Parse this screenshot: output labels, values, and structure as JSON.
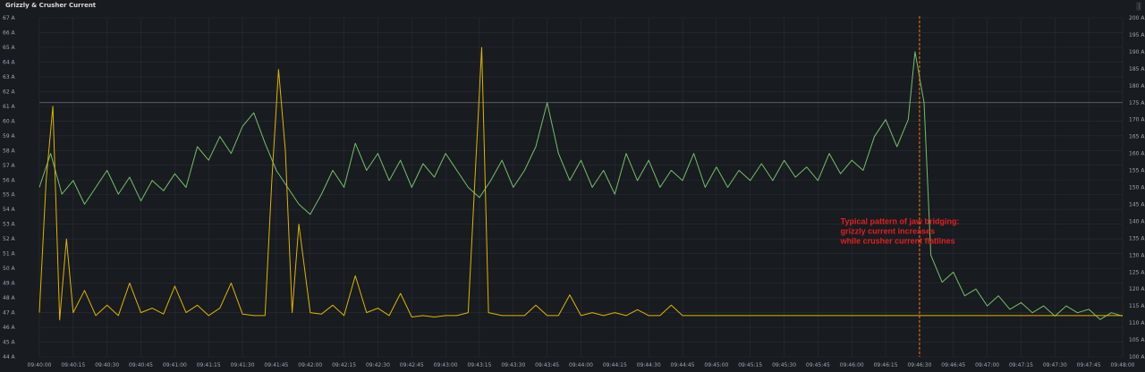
{
  "panel": {
    "title": "Grizzly & Crusher Current",
    "menu_glyph": "⋮"
  },
  "chart_data": {
    "type": "line",
    "title": "Grizzly & Crusher Current",
    "x_ticks": [
      "09:40:00",
      "09:40:15",
      "09:40:30",
      "09:40:45",
      "09:41:00",
      "09:41:15",
      "09:41:30",
      "09:41:45",
      "09:42:00",
      "09:42:15",
      "09:42:30",
      "09:42:45",
      "09:43:00",
      "09:43:15",
      "09:43:30",
      "09:43:45",
      "09:44:00",
      "09:44:15",
      "09:44:30",
      "09:44:45",
      "09:45:00",
      "09:45:15",
      "09:45:30",
      "09:45:45",
      "09:46:00",
      "09:46:15",
      "09:46:30",
      "09:46:45",
      "09:47:00",
      "09:47:15",
      "09:47:30",
      "09:47:45",
      "09:48:00"
    ],
    "xlim": [
      "09:40:00",
      "09:48:00"
    ],
    "y_left": {
      "ticks": [
        "44 A",
        "45 A",
        "46 A",
        "47 A",
        "48 A",
        "49 A",
        "50 A",
        "51 A",
        "52 A",
        "53 A",
        "54 A",
        "55 A",
        "56 A",
        "57 A",
        "58 A",
        "59 A",
        "60 A",
        "61 A",
        "62 A",
        "63 A",
        "64 A",
        "65 A",
        "66 A",
        "67 A"
      ],
      "range": [
        44,
        67
      ]
    },
    "y_right": {
      "ticks": [
        "100 A",
        "105 A",
        "110 A",
        "115 A",
        "120 A",
        "125 A",
        "130 A",
        "135 A",
        "140 A",
        "145 A",
        "150 A",
        "155 A",
        "160 A",
        "165 A",
        "170 A",
        "175 A",
        "180 A",
        "185 A",
        "190 A",
        "195 A",
        "200 A"
      ],
      "range": [
        100,
        200
      ]
    },
    "grid": true,
    "series": [
      {
        "color": "#73bf69",
        "axis": "right",
        "points": [
          [
            "09:40:00",
            150
          ],
          [
            "09:40:05",
            160
          ],
          [
            "09:40:10",
            148
          ],
          [
            "09:40:15",
            152
          ],
          [
            "09:40:20",
            145
          ],
          [
            "09:40:25",
            150
          ],
          [
            "09:40:30",
            155
          ],
          [
            "09:40:35",
            148
          ],
          [
            "09:40:40",
            153
          ],
          [
            "09:40:45",
            146
          ],
          [
            "09:40:50",
            152
          ],
          [
            "09:40:55",
            149
          ],
          [
            "09:41:00",
            154
          ],
          [
            "09:41:05",
            150
          ],
          [
            "09:41:10",
            162
          ],
          [
            "09:41:15",
            158
          ],
          [
            "09:41:20",
            165
          ],
          [
            "09:41:25",
            160
          ],
          [
            "09:41:30",
            168
          ],
          [
            "09:41:35",
            172
          ],
          [
            "09:41:40",
            163
          ],
          [
            "09:41:45",
            155
          ],
          [
            "09:41:50",
            150
          ],
          [
            "09:41:55",
            145
          ],
          [
            "09:42:00",
            142
          ],
          [
            "09:42:05",
            148
          ],
          [
            "09:42:10",
            155
          ],
          [
            "09:42:15",
            150
          ],
          [
            "09:42:20",
            163
          ],
          [
            "09:42:25",
            155
          ],
          [
            "09:42:30",
            160
          ],
          [
            "09:42:35",
            152
          ],
          [
            "09:42:40",
            158
          ],
          [
            "09:42:45",
            150
          ],
          [
            "09:42:50",
            157
          ],
          [
            "09:42:55",
            153
          ],
          [
            "09:43:00",
            160
          ],
          [
            "09:43:05",
            155
          ],
          [
            "09:43:10",
            150
          ],
          [
            "09:43:15",
            147
          ],
          [
            "09:43:20",
            152
          ],
          [
            "09:43:25",
            158
          ],
          [
            "09:43:30",
            150
          ],
          [
            "09:43:35",
            155
          ],
          [
            "09:43:40",
            162
          ],
          [
            "09:43:45",
            175
          ],
          [
            "09:43:50",
            160
          ],
          [
            "09:43:55",
            152
          ],
          [
            "09:44:00",
            158
          ],
          [
            "09:44:05",
            150
          ],
          [
            "09:44:10",
            155
          ],
          [
            "09:44:15",
            148
          ],
          [
            "09:44:20",
            160
          ],
          [
            "09:44:25",
            152
          ],
          [
            "09:44:30",
            158
          ],
          [
            "09:44:35",
            150
          ],
          [
            "09:44:40",
            155
          ],
          [
            "09:44:45",
            152
          ],
          [
            "09:44:50",
            160
          ],
          [
            "09:44:55",
            150
          ],
          [
            "09:45:00",
            156
          ],
          [
            "09:45:05",
            150
          ],
          [
            "09:45:10",
            155
          ],
          [
            "09:45:15",
            152
          ],
          [
            "09:45:20",
            157
          ],
          [
            "09:45:25",
            152
          ],
          [
            "09:45:30",
            158
          ],
          [
            "09:45:35",
            153
          ],
          [
            "09:45:40",
            156
          ],
          [
            "09:45:45",
            152
          ],
          [
            "09:45:50",
            160
          ],
          [
            "09:45:55",
            154
          ],
          [
            "09:46:00",
            158
          ],
          [
            "09:46:05",
            155
          ],
          [
            "09:46:10",
            165
          ],
          [
            "09:46:15",
            170
          ],
          [
            "09:46:20",
            162
          ],
          [
            "09:46:25",
            170
          ],
          [
            "09:46:28",
            190
          ],
          [
            "09:46:32",
            175
          ],
          [
            "09:46:35",
            130
          ],
          [
            "09:46:40",
            122
          ],
          [
            "09:46:45",
            125
          ],
          [
            "09:46:50",
            118
          ],
          [
            "09:46:55",
            120
          ],
          [
            "09:47:00",
            115
          ],
          [
            "09:47:05",
            118
          ],
          [
            "09:47:10",
            114
          ],
          [
            "09:47:15",
            116
          ],
          [
            "09:47:20",
            113
          ],
          [
            "09:47:25",
            115
          ],
          [
            "09:47:30",
            112
          ],
          [
            "09:47:35",
            115
          ],
          [
            "09:47:40",
            113
          ],
          [
            "09:47:45",
            114
          ],
          [
            "09:47:50",
            111
          ],
          [
            "09:47:55",
            113
          ],
          [
            "09:48:00",
            112
          ]
        ]
      },
      {
        "color": "#e0b400",
        "axis": "left",
        "points": [
          [
            "09:40:00",
            47
          ],
          [
            "09:40:03",
            56
          ],
          [
            "09:40:06",
            61
          ],
          [
            "09:40:09",
            46.5
          ],
          [
            "09:40:12",
            52
          ],
          [
            "09:40:15",
            47
          ],
          [
            "09:40:20",
            48.5
          ],
          [
            "09:40:25",
            46.8
          ],
          [
            "09:40:30",
            47.5
          ],
          [
            "09:40:35",
            46.8
          ],
          [
            "09:40:40",
            49
          ],
          [
            "09:40:45",
            47
          ],
          [
            "09:40:50",
            47.3
          ],
          [
            "09:40:55",
            46.9
          ],
          [
            "09:41:00",
            48.8
          ],
          [
            "09:41:05",
            47
          ],
          [
            "09:41:10",
            47.5
          ],
          [
            "09:41:15",
            46.8
          ],
          [
            "09:41:20",
            47.3
          ],
          [
            "09:41:25",
            49
          ],
          [
            "09:41:30",
            46.9
          ],
          [
            "09:41:35",
            46.8
          ],
          [
            "09:41:40",
            46.8
          ],
          [
            "09:41:43",
            56
          ],
          [
            "09:41:46",
            63.5
          ],
          [
            "09:41:49",
            58
          ],
          [
            "09:41:52",
            47
          ],
          [
            "09:41:55",
            53
          ],
          [
            "09:42:00",
            47
          ],
          [
            "09:42:05",
            46.9
          ],
          [
            "09:42:10",
            47.5
          ],
          [
            "09:42:15",
            46.8
          ],
          [
            "09:42:20",
            49.5
          ],
          [
            "09:42:25",
            47
          ],
          [
            "09:42:30",
            47.3
          ],
          [
            "09:42:35",
            46.8
          ],
          [
            "09:42:40",
            48.3
          ],
          [
            "09:42:45",
            46.7
          ],
          [
            "09:42:50",
            46.8
          ],
          [
            "09:42:55",
            46.7
          ],
          [
            "09:43:00",
            46.8
          ],
          [
            "09:43:05",
            46.8
          ],
          [
            "09:43:10",
            47
          ],
          [
            "09:43:13",
            56
          ],
          [
            "09:43:16",
            65
          ],
          [
            "09:43:19",
            47
          ],
          [
            "09:43:25",
            46.8
          ],
          [
            "09:43:30",
            46.8
          ],
          [
            "09:43:35",
            46.8
          ],
          [
            "09:43:40",
            47.5
          ],
          [
            "09:43:45",
            46.8
          ],
          [
            "09:43:50",
            46.8
          ],
          [
            "09:43:55",
            48.2
          ],
          [
            "09:44:00",
            46.8
          ],
          [
            "09:44:05",
            47
          ],
          [
            "09:44:10",
            46.8
          ],
          [
            "09:44:15",
            47
          ],
          [
            "09:44:20",
            46.8
          ],
          [
            "09:44:25",
            47.2
          ],
          [
            "09:44:30",
            46.8
          ],
          [
            "09:44:35",
            46.8
          ],
          [
            "09:44:40",
            47.5
          ],
          [
            "09:44:45",
            46.8
          ],
          [
            "09:44:50",
            46.8
          ],
          [
            "09:44:55",
            46.8
          ],
          [
            "09:45:00",
            46.8
          ],
          [
            "09:45:30",
            46.8
          ],
          [
            "09:46:00",
            46.8
          ],
          [
            "09:46:30",
            46.8
          ],
          [
            "09:47:00",
            46.8
          ],
          [
            "09:47:30",
            46.8
          ],
          [
            "09:48:00",
            46.8
          ]
        ]
      }
    ],
    "threshold_line": {
      "axis": "right",
      "value": 175,
      "color": "#7f8a95"
    },
    "vertical_marker": {
      "x": "09:46:30",
      "color": "#ff780a",
      "style": "dashed"
    },
    "annotation": {
      "lines": [
        "Typical pattern of jaw bridging:",
        "grizzly current increases",
        "while crusher current flatlines"
      ],
      "color": "#e02020",
      "at": {
        "x": "09:45:55",
        "y_left": 53
      }
    }
  }
}
